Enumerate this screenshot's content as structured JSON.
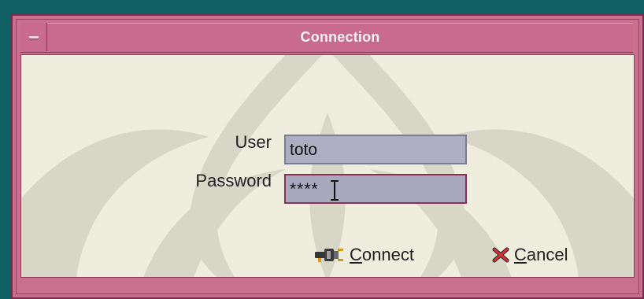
{
  "window": {
    "title": "Connection"
  },
  "form": {
    "user_label": "User",
    "user_value": "toto",
    "password_label": "Password",
    "password_value": "****"
  },
  "actions": {
    "connect": {
      "label_prefix": "C",
      "label_rest": "onnect",
      "icon": "plug-icon"
    },
    "cancel": {
      "label_prefix": "C",
      "label_rest": "ancel",
      "icon": "cancel-icon"
    }
  },
  "colors": {
    "desktop": "#0f5f63",
    "titlebar": "#c96b8d",
    "content_background": "#efedde",
    "field_background": "#adaec2",
    "password_focus_border": "#8a2f55"
  }
}
